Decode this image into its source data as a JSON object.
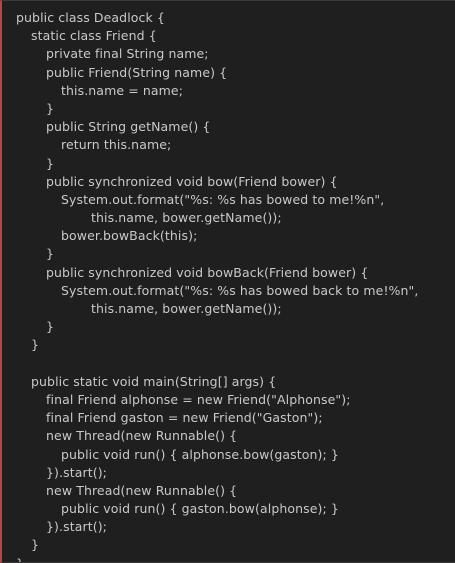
{
  "code": {
    "lines": [
      {
        "indent": 0,
        "text": "public class Deadlock {"
      },
      {
        "indent": 1,
        "text": "static class Friend {"
      },
      {
        "indent": 2,
        "text": "private final String name;"
      },
      {
        "indent": 2,
        "text": "public Friend(String name) {"
      },
      {
        "indent": 3,
        "text": "this.name = name;"
      },
      {
        "indent": 2,
        "text": "}"
      },
      {
        "indent": 2,
        "text": "public String getName() {"
      },
      {
        "indent": 3,
        "text": "return this.name;"
      },
      {
        "indent": 2,
        "text": "}"
      },
      {
        "indent": 2,
        "text": "public synchronized void bow(Friend bower) {"
      },
      {
        "indent": 3,
        "text": "System.out.format(\"%s: %s has bowed to me!%n\","
      },
      {
        "indent": 5,
        "text": "this.name, bower.getName());"
      },
      {
        "indent": 3,
        "text": "bower.bowBack(this);"
      },
      {
        "indent": 2,
        "text": "}"
      },
      {
        "indent": 2,
        "text": "public synchronized void bowBack(Friend bower) {"
      },
      {
        "indent": 3,
        "text": "System.out.format(\"%s: %s has bowed back to me!%n\","
      },
      {
        "indent": 5,
        "text": "this.name, bower.getName());"
      },
      {
        "indent": 2,
        "text": "}"
      },
      {
        "indent": 1,
        "text": "}"
      },
      {
        "indent": 0,
        "text": ""
      },
      {
        "indent": 1,
        "text": "public static void main(String[] args) {"
      },
      {
        "indent": 2,
        "text": "final Friend alphonse = new Friend(\"Alphonse\");"
      },
      {
        "indent": 2,
        "text": "final Friend gaston = new Friend(\"Gaston\");"
      },
      {
        "indent": 2,
        "text": "new Thread(new Runnable() {"
      },
      {
        "indent": 3,
        "text": "public void run() { alphonse.bow(gaston); }"
      },
      {
        "indent": 2,
        "text": "}).start();"
      },
      {
        "indent": 2,
        "text": "new Thread(new Runnable() {"
      },
      {
        "indent": 3,
        "text": "public void run() { gaston.bow(alphonse); }"
      },
      {
        "indent": 2,
        "text": "}).start();"
      },
      {
        "indent": 1,
        "text": "}"
      },
      {
        "indent": 0,
        "text": "}"
      }
    ]
  },
  "colors": {
    "background": "#1f1f1f",
    "text": "#c9c9c9",
    "accent_border": "#b8453f"
  }
}
